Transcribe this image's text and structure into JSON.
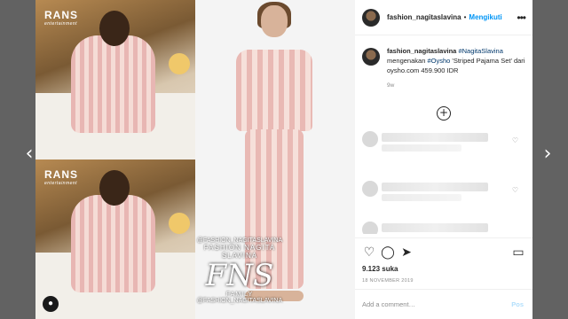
{
  "post": {
    "username": "fashion_nagitaslavina",
    "follow_label": "Mengikuti",
    "separator": "•",
    "more_icon": "more-icon",
    "caption": {
      "username": "fashion_nagitaslavina",
      "tag1": "#NagitaSlavina",
      "text1": " mengenakan ",
      "tag2": "#Oysho",
      "text2": " 'Striped Pajama Set' dari oysho.com 459.900 IDR"
    },
    "time_ago": "9w",
    "likes": "9.123 suka",
    "date": "18 NOVEMBER 2019",
    "add_comment_placeholder": "Add a comment…",
    "post_label": "Pos"
  },
  "media": {
    "brand_top": "RANS",
    "brand_top_sub": "entertainment",
    "brand_bottom": "RANS",
    "brand_bottom_sub": "entertainment",
    "watermark_handle": "@FASHION_NAGITASLAVINA",
    "watermark_name": "FASHION NAGITA SLAVINA",
    "watermark_logo": "FNS",
    "watermark_family": "FAMILY",
    "watermark_handle2": "@FASHION_NAGITASLAVINA"
  },
  "icons": {
    "prev": "‹",
    "next": "›",
    "load_more": "+",
    "like": "♡",
    "comment": "◯",
    "share": "➤",
    "save": "▭",
    "heart": "♡"
  }
}
